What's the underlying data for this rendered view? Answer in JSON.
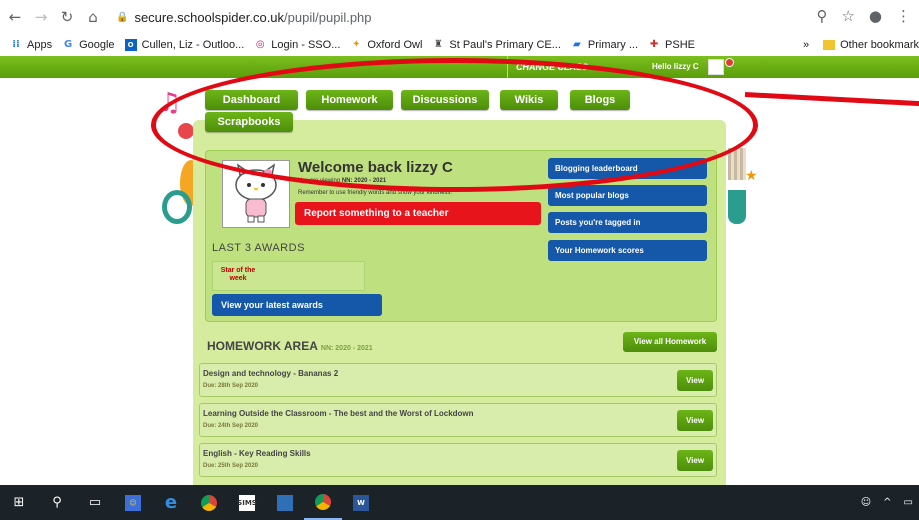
{
  "browser": {
    "url_host": "secure.schoolspider.co.uk",
    "url_path": "/pupil/pupil.php",
    "bookmarks": [
      {
        "label": "Apps",
        "icon": "apps-grid-icon"
      },
      {
        "label": "Google",
        "icon": "google-icon"
      },
      {
        "label": "Cullen, Liz - Outloo...",
        "icon": "outlook-icon"
      },
      {
        "label": "Login - SSO...",
        "icon": "login-icon"
      },
      {
        "label": "Oxford Owl",
        "icon": "owl-icon"
      },
      {
        "label": "St Paul's Primary CE...",
        "icon": "school-icon"
      },
      {
        "label": "Primary ...",
        "icon": "primary-icon"
      },
      {
        "label": "PSHE",
        "icon": "pshe-icon"
      }
    ],
    "other_bookmarks": "Other bookmark",
    "overflow": "»"
  },
  "topbar": {
    "change_class": "CHANGE CLASS",
    "hello": "Hello lizzy C"
  },
  "nav": {
    "tabs": [
      "Dashboard",
      "Homework",
      "Discussions",
      "Wikis",
      "Blogs",
      "Scrapbooks"
    ]
  },
  "welcome": {
    "title": "Welcome back lizzy C",
    "viewing_prefix": "You are viewing ",
    "viewing_value": "NN: 2020 - 2021",
    "kindness": "Remember to use friendly words and show your kindness.",
    "report_button": "Report something to a teacher"
  },
  "awards": {
    "title": "LAST 3 AWARDS",
    "badge": "Star of the week",
    "button": "View your latest awards"
  },
  "side_links": [
    "Blogging leaderboard",
    "Most popular blogs",
    "Posts you're tagged in",
    "Your Homework scores"
  ],
  "homework": {
    "title": "HOMEWORK AREA",
    "subtitle": "NN: 2020 - 2021",
    "view_all": "View all Homework",
    "items": [
      {
        "name": "Design and technology - Bananas 2",
        "due": "Due: 28th Sep 2020",
        "button": "View"
      },
      {
        "name": "Learning Outside the Classroom - The best and the Worst of Lockdown",
        "due": "Due: 24th Sep 2020",
        "button": "View"
      },
      {
        "name": "English - Key Reading Skills",
        "due": "Due: 25th Sep 2020",
        "button": "View"
      }
    ]
  },
  "colors": {
    "green": "#5a9e0c",
    "blue": "#1557a9",
    "red": "#e8141b",
    "annotation": "#e10a14"
  }
}
